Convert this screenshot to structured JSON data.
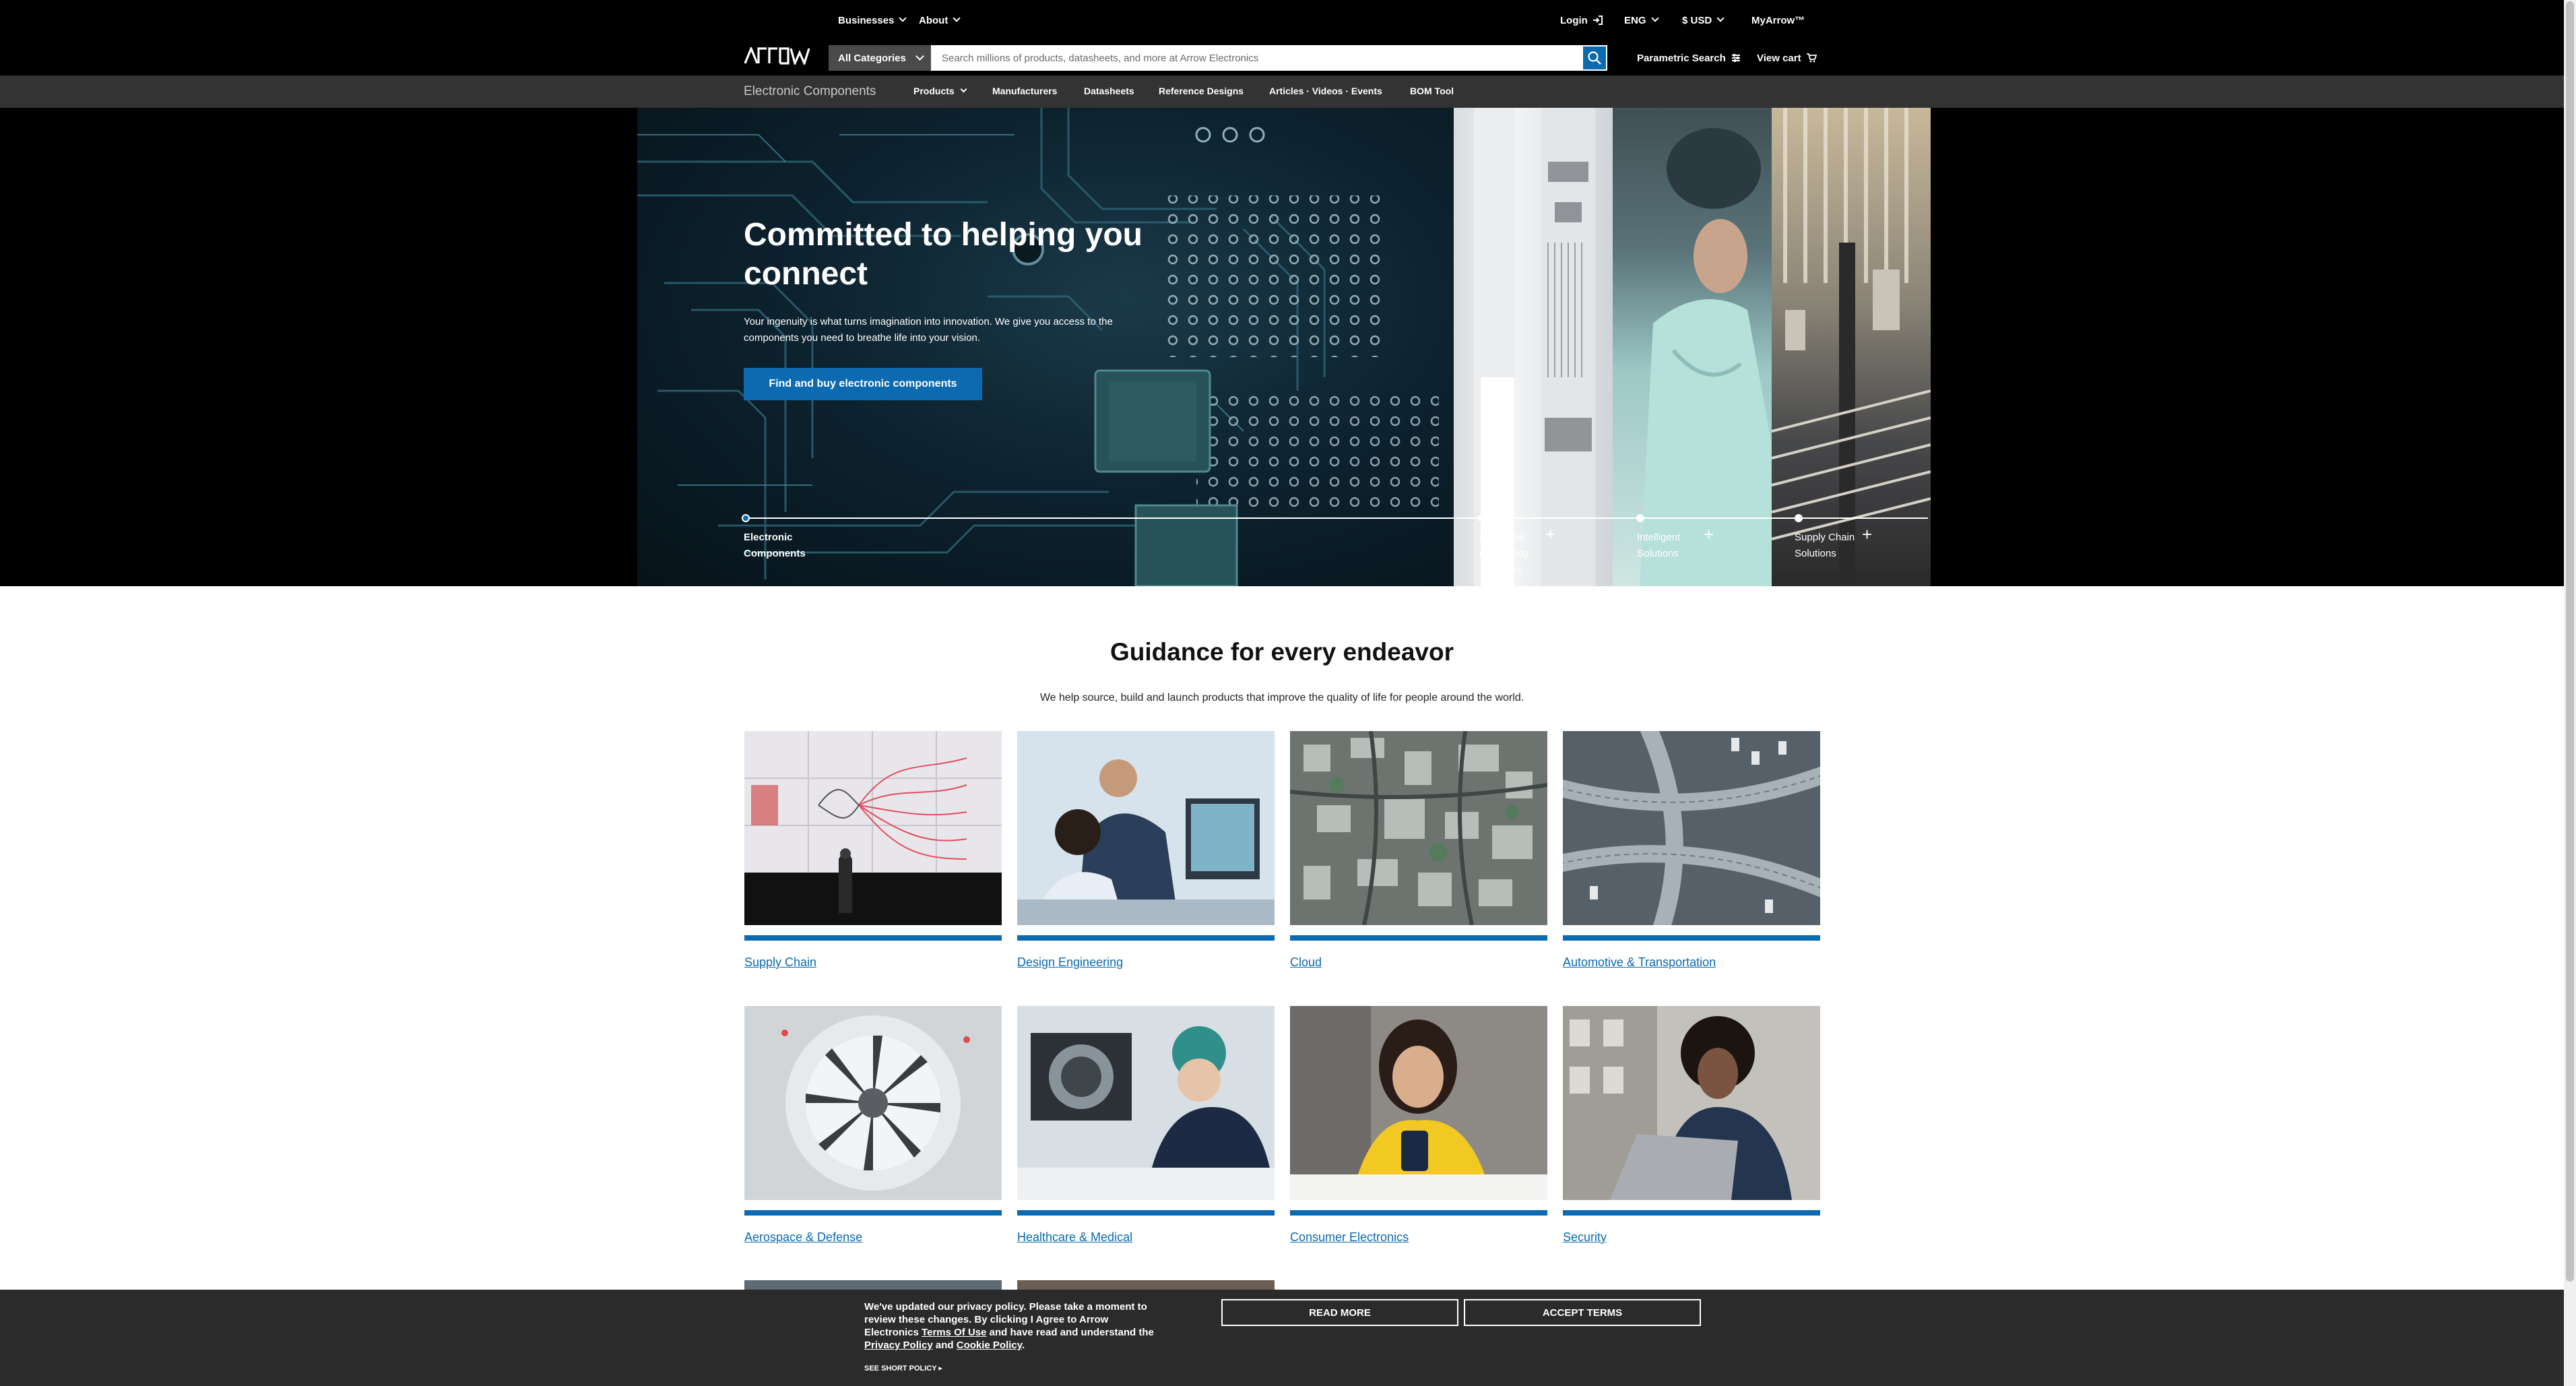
{
  "header": {
    "menu": [
      {
        "label": "Businesses"
      },
      {
        "label": "About"
      }
    ],
    "login": "Login",
    "language": "ENG",
    "currency": "$ USD",
    "myarrow": "MyArrow™",
    "search": {
      "category": "All Categories",
      "placeholder": "Search millions of products, datasheets, and more at Arrow Electronics"
    },
    "parametric_search": "Parametric Search",
    "view_cart": "View cart"
  },
  "subnav": {
    "brand": "Electronic Components",
    "items": [
      "Products",
      "Manufacturers",
      "Datasheets",
      "Reference Designs",
      "Articles · Videos · Events",
      "BOM Tool"
    ]
  },
  "hero": {
    "title": "Committed to helping you connect",
    "lead": "Your ingenuity is what turns imagination into innovation. We give you access to the components you need to breathe life into your vision.",
    "cta": "Find and buy electronic components",
    "tabs": [
      {
        "label": "Electronic Components"
      },
      {
        "label": "Enterprise Computing Solutions"
      },
      {
        "label": "Intelligent Solutions"
      },
      {
        "label": "Supply Chain Solutions"
      }
    ]
  },
  "guidance": {
    "title": "Guidance for every endeavor",
    "subtitle": "We help source, build and launch products that improve the quality of life for people around the world.",
    "cards": [
      {
        "label": "Supply Chain"
      },
      {
        "label": "Design Engineering"
      },
      {
        "label": "Cloud"
      },
      {
        "label": "Automotive & Transportation"
      },
      {
        "label": "Aerospace & Defense"
      },
      {
        "label": "Healthcare & Medical"
      },
      {
        "label": "Consumer Electronics"
      },
      {
        "label": "Security"
      }
    ]
  },
  "cookie": {
    "text_1": "We've updated our privacy policy. Please take a moment to review these changes. By clicking I Agree to Arrow Electronics",
    "terms_link": "Terms Of Use",
    "text_2": "and have read and understand the",
    "privacy_link": "Privacy Policy",
    "text_3": "and",
    "cookie_link": "Cookie Policy",
    "text_4": ".",
    "short_policy": "SEE SHORT POLICY ▸",
    "read_more": "READ MORE",
    "accept": "ACCEPT TERMS"
  },
  "colors": {
    "accent": "#0b6ab0",
    "header_bg": "#000000",
    "subnav_bg": "#333333",
    "cookie_bg": "#2b2b2b"
  }
}
